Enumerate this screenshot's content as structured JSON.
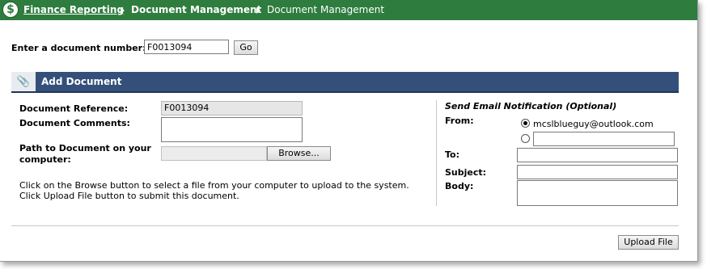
{
  "breadcrumb": {
    "items": [
      "Finance Reporting",
      "Document Management",
      "Document Management"
    ]
  },
  "lookup": {
    "label": "Enter a document number:",
    "value": "F0013094",
    "go_label": "Go"
  },
  "section": {
    "title": "Add Document",
    "icon": "attachment-icon"
  },
  "form": {
    "reference_label": "Document Reference:",
    "reference_value": "F0013094",
    "comments_label": "Document Comments:",
    "path_label_1": "Path to Document on your",
    "path_label_2": "computer:",
    "browse_label": "Browse...",
    "help_line_1": "Click on the Browse button to select a file from your computer to upload to the system.",
    "help_line_2": "Click Upload File button to submit this document."
  },
  "email": {
    "heading": "Send Email Notification (Optional)",
    "from_label": "From:",
    "from_option_1": "mcslblueguy@outlook.com",
    "to_label": "To:",
    "subject_label": "Subject:",
    "body_label": "Body:"
  },
  "actions": {
    "upload_label": "Upload File"
  }
}
